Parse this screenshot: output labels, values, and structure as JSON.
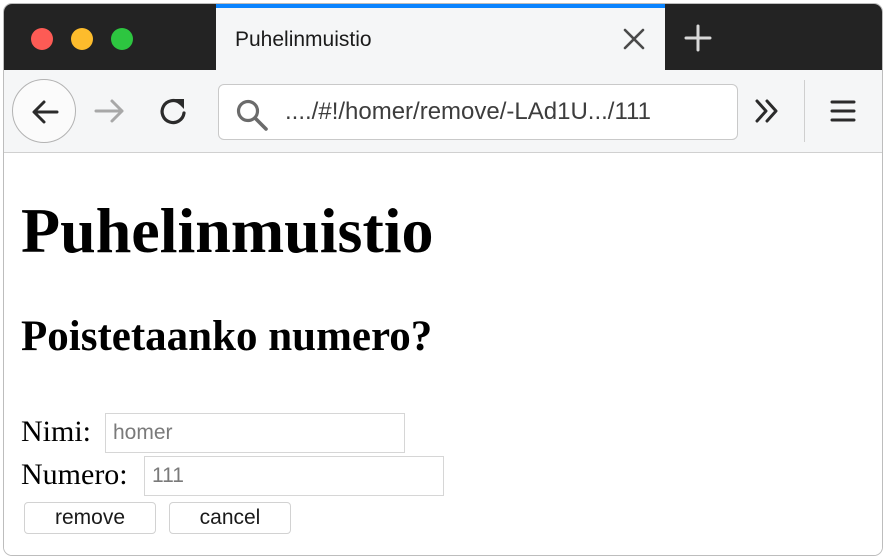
{
  "browser": {
    "tab": {
      "title": "Puhelinmuistio"
    },
    "url": "..../#!/homer/remove/-LAd1U.../111",
    "icons": {
      "back": "arrow-left-icon",
      "forward": "arrow-right-icon",
      "reload": "reload-icon",
      "search": "search-icon",
      "overflow": "double-chevron-right-icon",
      "menu": "hamburger-menu-icon",
      "tab_close": "close-icon",
      "new_tab": "plus-icon"
    },
    "colors": {
      "tab_accent": "#0a84ff",
      "close": "#fd5b55",
      "minimize": "#fdbc2c",
      "maximize": "#2dc640",
      "titlebar": "#232323"
    }
  },
  "page": {
    "heading": "Puhelinmuistio",
    "subheading": "Poistetaanko numero?",
    "form": {
      "name_label": "Nimi:",
      "name_value": "homer",
      "number_label": "Numero:",
      "number_value": "111",
      "remove_label": "remove",
      "cancel_label": "cancel"
    }
  }
}
